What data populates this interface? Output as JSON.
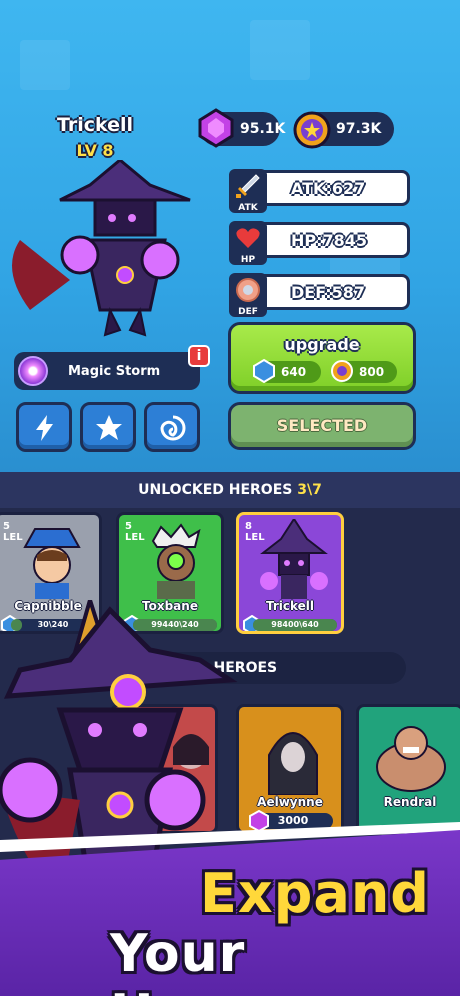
{
  "hero": {
    "name": "Trickell",
    "level": "LV 8"
  },
  "currency": {
    "gems": "95.1K",
    "medals": "97.3K"
  },
  "stats": {
    "atk": {
      "tag": "ATK",
      "value": "ATK:627"
    },
    "hp": {
      "tag": "HP",
      "value": "HP:7845"
    },
    "def": {
      "tag": "DEF",
      "value": "DEF:587"
    }
  },
  "skill": {
    "name": "Magic Storm",
    "info": "i"
  },
  "upgrade": {
    "label": "upgrade",
    "cost_gems": "640",
    "cost_medals": "800"
  },
  "selected_label": "SELECTED",
  "unlocked": {
    "title": "UNLOCKED HEROES",
    "count": "3\\7"
  },
  "heroes": [
    {
      "level": "5",
      "lvl_tag": "LEL",
      "name": "Capnibble",
      "progress": "30\\240",
      "fill": 0.125,
      "color": "#9aa0ad"
    },
    {
      "level": "5",
      "lvl_tag": "LEL",
      "name": "Toxbane",
      "progress": "99440\\240",
      "fill": 1.0,
      "color": "#3fbf4a"
    },
    {
      "level": "8",
      "lvl_tag": "LEL",
      "name": "Trickell",
      "progress": "98400\\640",
      "fill": 1.0,
      "color": "#8b47d8"
    }
  ],
  "locked": {
    "title": "LOCKED HEROES",
    "cards": [
      {
        "name": "Aelwynne",
        "price": "3000",
        "color": "#d8901c"
      },
      {
        "name": "Rendral",
        "price": "",
        "color": "#21a37c"
      }
    ]
  },
  "promo": {
    "line1": "Expand",
    "line2": "Your Heroes"
  },
  "colors": {
    "accent_green": "#7fcf28",
    "panel_navy": "#1e2e55",
    "sky": "#3fb6f0",
    "purple": "#8b47d8",
    "gold": "#ffd83a"
  }
}
